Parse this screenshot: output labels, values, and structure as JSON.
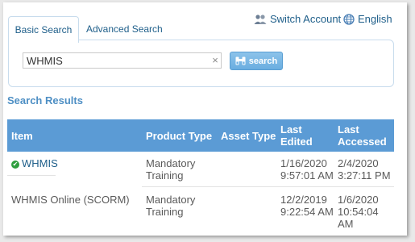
{
  "tabs": {
    "basic": "Basic Search",
    "advanced": "Advanced Search"
  },
  "header": {
    "switch_account": "Switch Account",
    "language": "English"
  },
  "search": {
    "value": "WHMIS",
    "clear": "×",
    "button_label": "search"
  },
  "results": {
    "title": "Search Results",
    "columns": {
      "item": "Item",
      "product_type": "Product Type",
      "asset_type": "Asset Type",
      "last_edited": "Last\nEdited",
      "last_accessed": "Last\nAccessed"
    },
    "rows": [
      {
        "item": "WHMIS",
        "status": "✔",
        "product_type": "Mandatory\nTraining",
        "asset_type": "",
        "last_edited": "1/16/2020\n9:57:01 AM",
        "last_accessed": "2/4/2020\n3:27:11 PM"
      },
      {
        "item": "WHMIS Online (SCORM)",
        "product_type": "Mandatory\nTraining",
        "asset_type": "",
        "last_edited": "12/2/2019\n9:22:54 AM",
        "last_accessed": "1/6/2020\n10:54:04\nAM"
      }
    ]
  },
  "colors": {
    "header_bg": "#5b9bd5",
    "link": "#1f5f8a",
    "check": "#2e9e3e"
  }
}
